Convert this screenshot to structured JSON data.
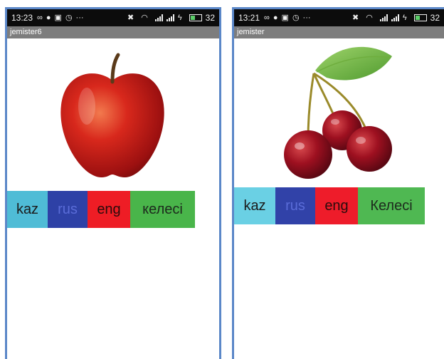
{
  "screens": [
    {
      "status": {
        "time": "13:23",
        "battery": "32"
      },
      "app_title": "jemister6",
      "fruit_icon": "apple-icon",
      "buttons": [
        {
          "label": "kaz",
          "color": "#4fbcd6",
          "text_color": "#1b1b1b"
        },
        {
          "label": "rus",
          "color": "#2e41a6",
          "text_color": "#5a6cd8"
        },
        {
          "label": "eng",
          "color": "#ee1d25",
          "text_color": "#2a0c0c"
        },
        {
          "label": "келесі",
          "color": "#49b54a",
          "text_color": "#1d2a1d"
        }
      ]
    },
    {
      "status": {
        "time": "13:21",
        "battery": "32"
      },
      "app_title": "jemister",
      "fruit_icon": "cherries-icon",
      "buttons": [
        {
          "label": "kaz",
          "color": "#6ad0e4",
          "text_color": "#1b1b1b"
        },
        {
          "label": "rus",
          "color": "#3142a8",
          "text_color": "#5a6cd8"
        },
        {
          "label": "eng",
          "color": "#ee1c2a",
          "text_color": "#2a0c0c"
        },
        {
          "label": "Келесі",
          "color": "#4fb852",
          "text_color": "#1d2a1d"
        }
      ]
    }
  ]
}
